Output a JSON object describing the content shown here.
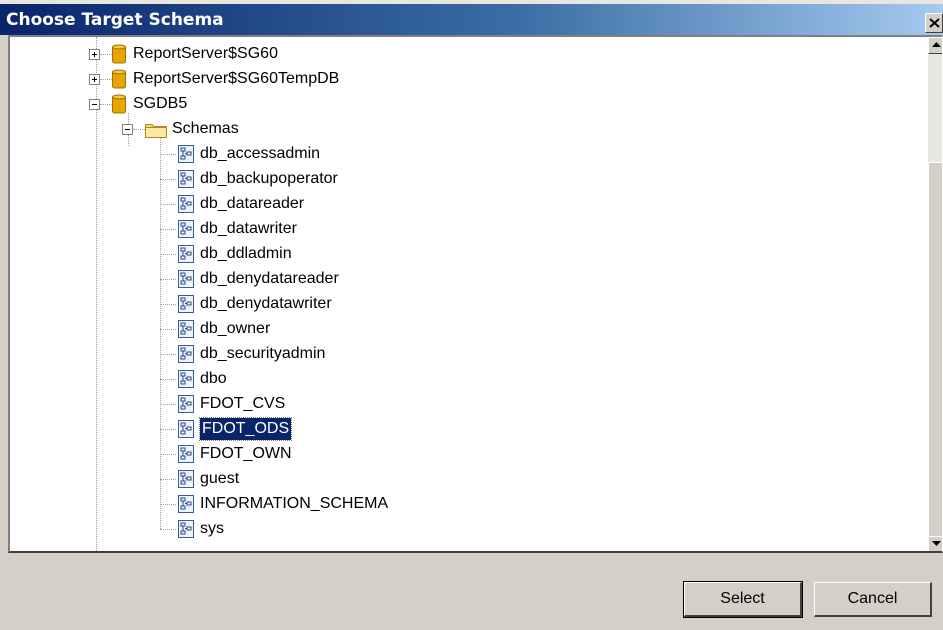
{
  "window": {
    "title": "Choose Target Schema"
  },
  "tree": {
    "databases": [
      {
        "label": "ReportServer$SG60",
        "expanded": false
      },
      {
        "label": "ReportServer$SG60TempDB",
        "expanded": false
      },
      {
        "label": "SGDB5",
        "expanded": true
      }
    ],
    "schemas_folder": "Schemas",
    "schemas": [
      "db_accessadmin",
      "db_backupoperator",
      "db_datareader",
      "db_datawriter",
      "db_ddladmin",
      "db_denydatareader",
      "db_denydatawriter",
      "db_owner",
      "db_securityadmin",
      "dbo",
      "FDOT_CVS",
      "FDOT_ODS",
      "FDOT_OWN",
      "guest",
      "INFORMATION_SCHEMA",
      "sys"
    ],
    "selected_schema": "FDOT_ODS"
  },
  "buttons": {
    "select": "Select",
    "cancel": "Cancel"
  },
  "colors": {
    "selection": "#0a246a",
    "dialog": "#d4d0c8",
    "database_icon": "#e8a500",
    "folder_icon": "#f6d86b"
  }
}
